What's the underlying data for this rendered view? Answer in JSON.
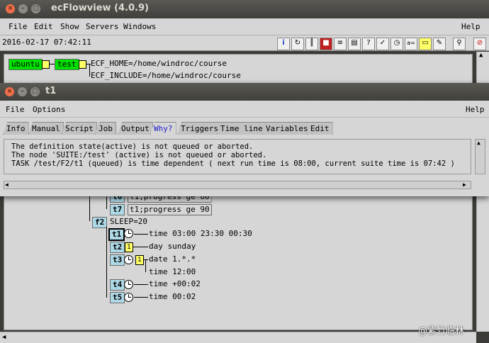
{
  "main_window": {
    "title": "ecFlowview (4.0.9)",
    "menu": [
      "File",
      "Edit",
      "Show",
      "Servers",
      "Windows"
    ],
    "help": "Help",
    "timestamp": "2016-02-17 07:42:11"
  },
  "tree": {
    "server": "ubuntu",
    "suite": "test",
    "vars": [
      "ECF_HOME=/home/windroc/course",
      "ECF_INCLUDE=/home/windroc/course"
    ],
    "t6": {
      "name": "t6",
      "trigger": "t1;progress ge 60"
    },
    "t7": {
      "name": "t7",
      "trigger": "t1;progress ge 90"
    },
    "f2": {
      "name": "f2",
      "var": "SLEEP=20"
    },
    "tasks": [
      {
        "name": "t1",
        "attrs": [
          "time 03:00 23:30 00:30"
        ]
      },
      {
        "name": "t2",
        "attrs": [
          "day sunday"
        ]
      },
      {
        "name": "t3",
        "attrs": [
          "date 1.*.*",
          "time 12:00"
        ]
      },
      {
        "name": "t4",
        "attrs": [
          "time +00:02"
        ]
      },
      {
        "name": "t5",
        "attrs": [
          "time 00:02"
        ]
      }
    ]
  },
  "t1_window": {
    "title": "t1",
    "menu": [
      "File",
      "Options"
    ],
    "help": "Help",
    "tabs": [
      "Info",
      "Manual",
      "Script",
      "Job",
      "Output",
      "Why?",
      "Triggers",
      "Time line",
      "Variables",
      "Edit"
    ],
    "active_tab": "Why?",
    "messages": [
      "The definition state(active) is not queued or aborted.",
      "The node 'SUITE:/test' (active) is not queued or aborted.",
      "TASK /test/F2/t1 (queued) is time dependent ( next run time is 08:00, current suite time is 07:42 )"
    ]
  },
  "watermark": "@紫竹临林",
  "colors": {
    "server_green": "#00e000",
    "task_blue": "#add8e6",
    "badge_yellow": "#ffff66"
  }
}
